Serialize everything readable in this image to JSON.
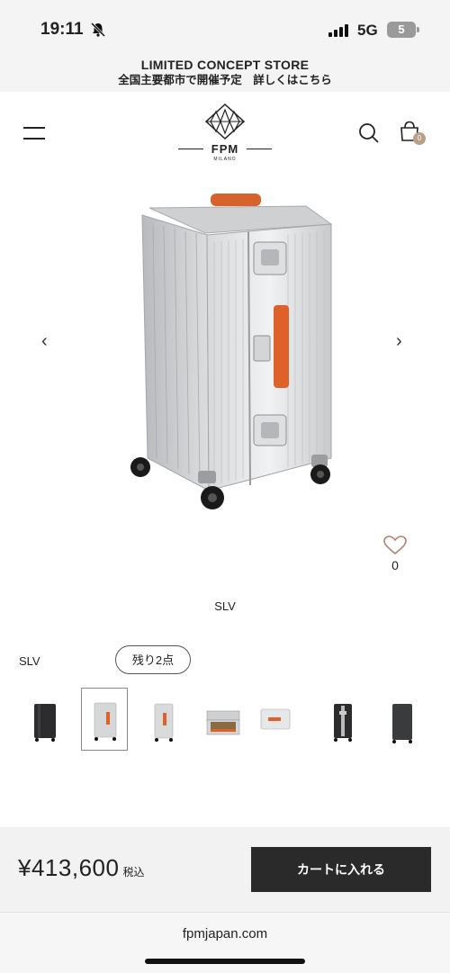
{
  "status_bar": {
    "time": "19:11",
    "network": "5G",
    "battery": "5"
  },
  "promo": {
    "title": "LIMITED CONCEPT STORE",
    "subtitle": "全国主要都市で開催予定　詳しくはこちら"
  },
  "header": {
    "logo_text": "FPM",
    "logo_sub": "MILANO",
    "cart_count": "0"
  },
  "product": {
    "favorites_count": "0",
    "variant_caption": "SLV",
    "color_label": "SLV",
    "stock": "残り2点",
    "thumbnails": [
      "black",
      "silver-orange",
      "silver",
      "open-case",
      "silver-side",
      "black-orange",
      "dark-grey"
    ],
    "selected_thumbnail": 1
  },
  "purchase": {
    "price": "¥413,600",
    "tax_label": "税込",
    "cart_button": "カートに入れる"
  },
  "browser": {
    "url": "fpmjapan.com"
  },
  "colors": {
    "accent_orange": "#e0602a",
    "button_dark": "#2a2a2a",
    "cart_badge": "#b89f88"
  }
}
